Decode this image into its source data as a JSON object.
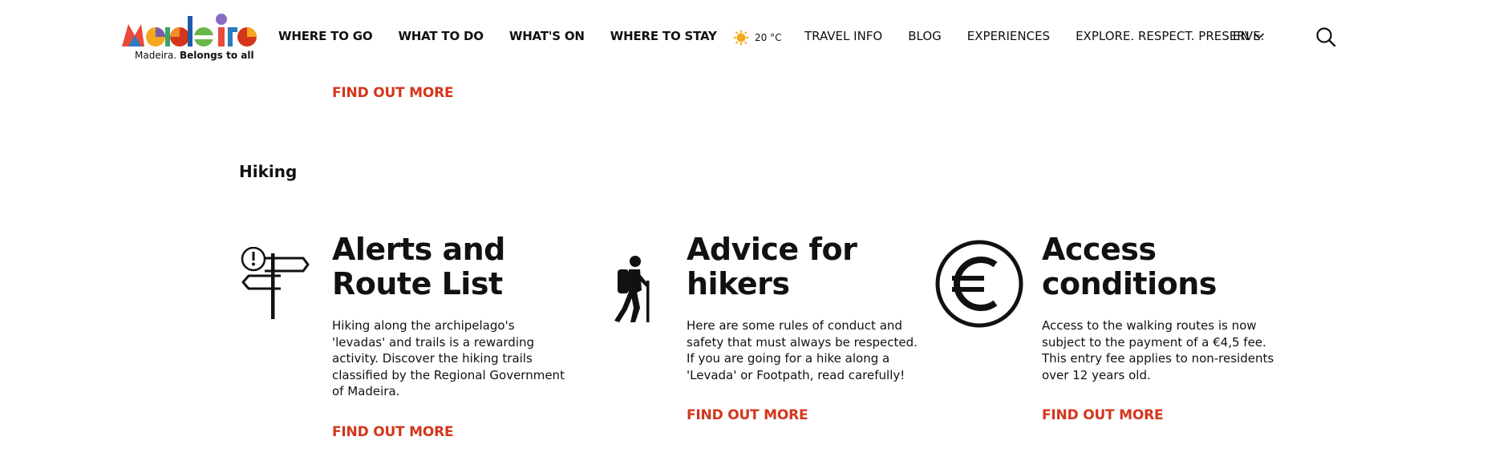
{
  "brand": {
    "tagline_plain": "Madeira.",
    "tagline_bold": "Belongs to all",
    "colors": {
      "accent": "#d4361c",
      "text": "#111111"
    }
  },
  "nav": {
    "main": [
      "WHERE TO GO",
      "WHAT TO DO",
      "WHAT'S ON",
      "WHERE TO STAY"
    ],
    "weather": {
      "icon": "sun-icon",
      "temp": "20 °C"
    },
    "secondary": [
      "TRAVEL INFO",
      "BLOG",
      "EXPERIENCES",
      "EXPLORE. RESPECT. PRESERVE."
    ],
    "language": "EN"
  },
  "top_link": "FIND OUT MORE",
  "section": {
    "title": "Hiking"
  },
  "cards": [
    {
      "icon": "signpost-alert-icon",
      "title": "Alerts and Route List",
      "description": "Hiking along the archipelago's 'levadas' and trails is a rewarding activity. Discover the hiking trails classified by the Regional Government of Madeira.",
      "link": "FIND OUT MORE"
    },
    {
      "icon": "hiker-icon",
      "title": "Advice for hikers",
      "description": "Here are some rules of conduct and safety that must always be respected. If you are going for a hike along a 'Levada' or Footpath, read carefully!",
      "link": "FIND OUT MORE"
    },
    {
      "icon": "euro-icon",
      "title": "Access conditions",
      "description": "Access to the walking routes is now subject to the payment of a €4,5 fee. This entry fee applies to non-residents over 12 years old.",
      "link": "FIND OUT MORE"
    }
  ]
}
